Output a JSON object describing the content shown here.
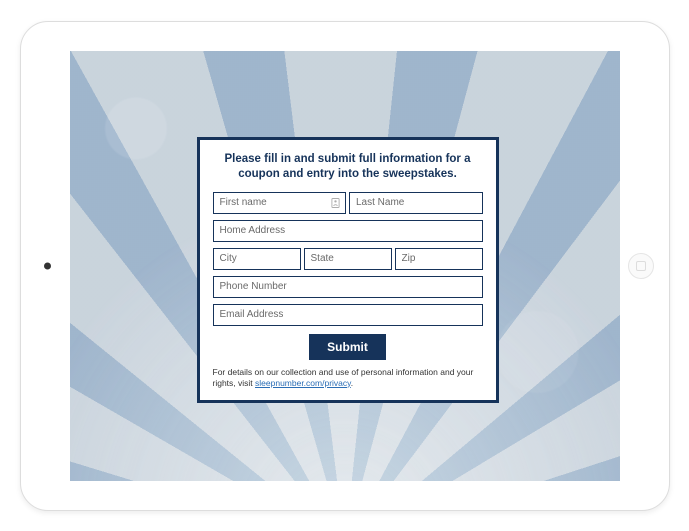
{
  "form": {
    "heading": "Please fill in and submit full information for a coupon and entry into the sweepstakes.",
    "fields": {
      "first_name": "First name",
      "last_name": "Last Name",
      "home_address": "Home Address",
      "city": "City",
      "state": "State",
      "zip": "Zip",
      "phone": "Phone Number",
      "email": "Email Address"
    },
    "submit_label": "Submit",
    "disclaimer_text": "For details on our collection and use of personal information and your rights, visit ",
    "disclaimer_link": "sleepnumber.com/privacy",
    "disclaimer_suffix": "."
  }
}
